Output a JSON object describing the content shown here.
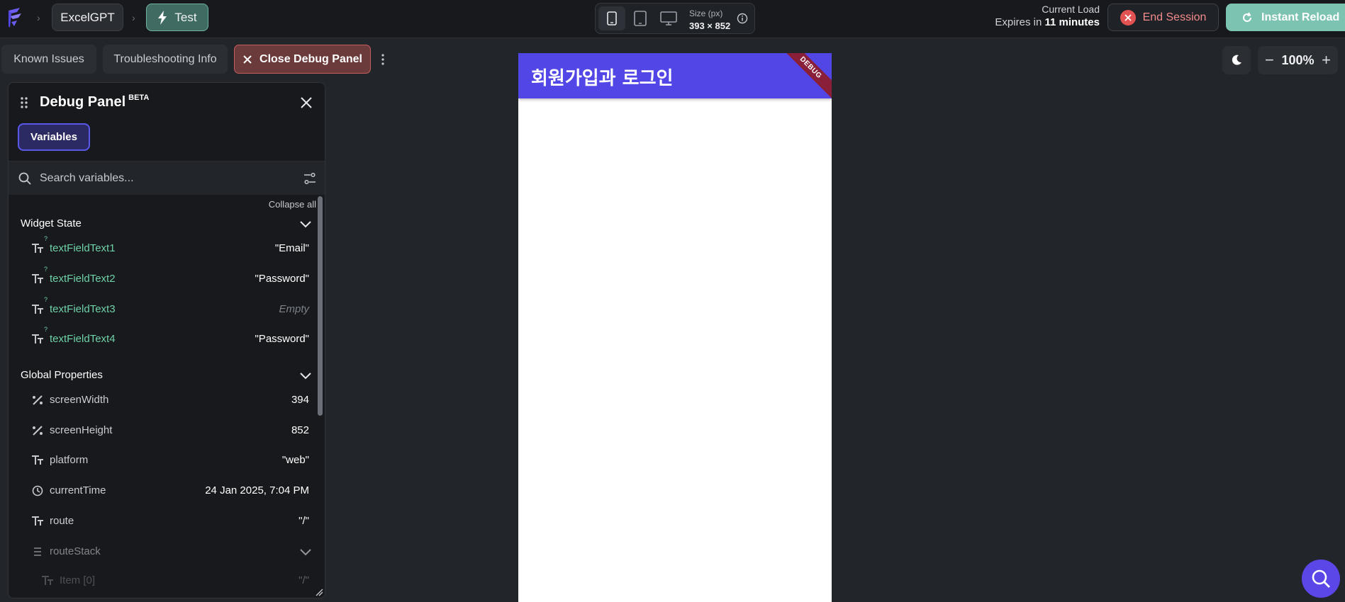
{
  "header": {
    "project_name": "ExcelGPT",
    "branch_name": "Test",
    "size_label": "Size (px)",
    "size_value": "393 × 852",
    "load_label": "Current Load",
    "expires_prefix": "Expires in ",
    "expires_value": "11 minutes",
    "end_session_label": "End Session",
    "instant_reload_label": "Instant Reload"
  },
  "toolbar": {
    "known_issues_label": "Known Issues",
    "troubleshooting_label": "Troubleshooting Info",
    "close_debug_label": "Close Debug Panel",
    "zoom_value": "100%"
  },
  "debug_panel": {
    "title": "Debug Panel",
    "badge": "BETA",
    "tab_label": "Variables",
    "search_placeholder": "Search variables...",
    "collapse_all_label": "Collapse all",
    "widget_state": {
      "title": "Widget State",
      "items": [
        {
          "name": "textFieldText1",
          "value": "\"Email\"",
          "icon": "text-type-icon"
        },
        {
          "name": "textFieldText2",
          "value": "\"Password\"",
          "icon": "text-type-icon"
        },
        {
          "name": "textFieldText3",
          "value": "Empty",
          "icon": "text-type-icon"
        },
        {
          "name": "textFieldText4",
          "value": "\"Password\"",
          "icon": "text-type-icon"
        }
      ]
    },
    "global_properties": {
      "title": "Global Properties",
      "items": [
        {
          "name": "screenWidth",
          "value": "394",
          "icon": "percent-icon"
        },
        {
          "name": "screenHeight",
          "value": "852",
          "icon": "percent-icon"
        },
        {
          "name": "platform",
          "value": "\"web\"",
          "icon": "text-type-icon"
        },
        {
          "name": "currentTime",
          "value": "24 Jan 2025, 7:04 PM",
          "icon": "clock-icon"
        },
        {
          "name": "route",
          "value": "\"/\"",
          "icon": "text-type-icon"
        },
        {
          "name": "routeStack",
          "value": "",
          "icon": "list-icon"
        },
        {
          "name": "Item [0]",
          "value": "\"/\"",
          "icon": "text-type-icon"
        }
      ]
    }
  },
  "preview": {
    "app_title": "회원가입과 로그인",
    "debug_ribbon": "DEBUG"
  },
  "colors": {
    "accent": "#5246e6",
    "success": "#7cc3b1",
    "danger": "#e35252",
    "variable_name": "#6fd1a8"
  }
}
